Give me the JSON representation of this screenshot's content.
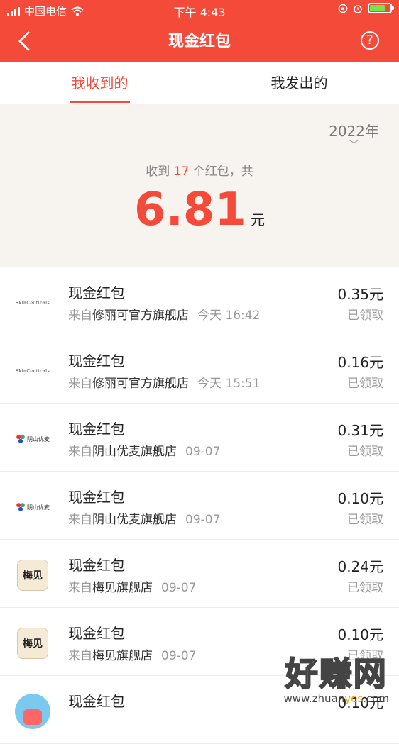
{
  "status_bar": {
    "carrier": "中国电信",
    "time": "下午 4:43"
  },
  "header": {
    "title": "现金红包",
    "help": "?"
  },
  "tabs": [
    {
      "label": "我收到的",
      "active": true
    },
    {
      "label": "我发出的",
      "active": false
    }
  ],
  "summary": {
    "year": "2022年",
    "count_prefix": "收到",
    "count": "17",
    "count_suffix": "个红包，共",
    "amount": "6.81",
    "unit": "元"
  },
  "items": [
    {
      "title": "现金红包",
      "from": "来自",
      "store": "修丽可官方旗舰店",
      "time": "今天 16:42",
      "amount": "0.35元",
      "status": "已领取",
      "logo": "SkinCeuticals"
    },
    {
      "title": "现金红包",
      "from": "来自",
      "store": "修丽可官方旗舰店",
      "time": "今天 15:51",
      "amount": "0.16元",
      "status": "已领取",
      "logo": "SkinCeuticals"
    },
    {
      "title": "现金红包",
      "from": "来自",
      "store": "阴山优麦旗舰店",
      "time": "09-07",
      "amount": "0.31元",
      "status": "已领取",
      "logo": "阴山优麦"
    },
    {
      "title": "现金红包",
      "from": "来自",
      "store": "阴山优麦旗舰店",
      "time": "09-07",
      "amount": "0.10元",
      "status": "已领取",
      "logo": "阴山优麦"
    },
    {
      "title": "现金红包",
      "from": "来自",
      "store": "梅见旗舰店",
      "time": "09-07",
      "amount": "0.24元",
      "status": "已领取",
      "logo": "梅见"
    },
    {
      "title": "现金红包",
      "from": "来自",
      "store": "梅见旗舰店",
      "time": "09-07",
      "amount": "0.10元",
      "status": "已领取",
      "logo": "梅见"
    },
    {
      "title": "现金红包",
      "from": "",
      "store": "",
      "time": "",
      "amount": "0.10元",
      "status": "",
      "logo": ""
    }
  ],
  "watermark": {
    "big": "好赚网",
    "small_a": "www.zhuan",
    "small_b": "yes",
    "small_c": ".com"
  },
  "colors": {
    "accent": "#f44a3a",
    "summary_bg": "#f7f3ef"
  }
}
